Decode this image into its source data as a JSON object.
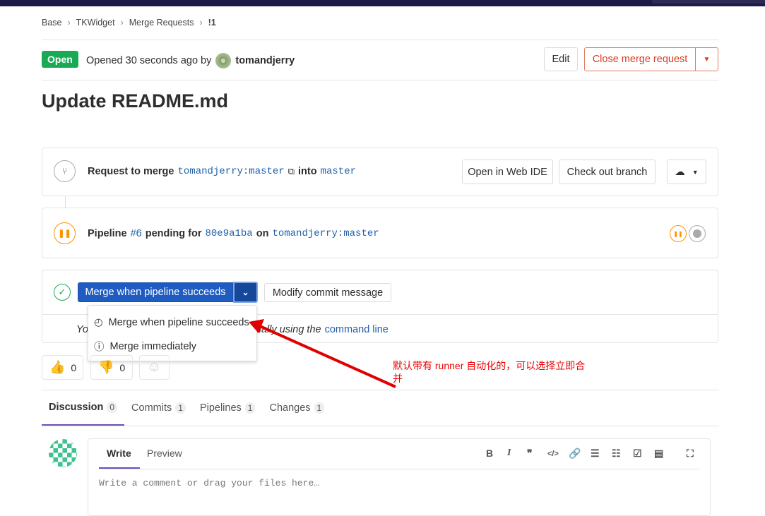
{
  "breadcrumb": [
    "Base",
    "TKWidget",
    "Merge Requests",
    "!1"
  ],
  "status": "Open",
  "opened_text": "Opened 30 seconds ago by",
  "author": "tomandjerry",
  "edit": "Edit",
  "close_mr": "Close merge request",
  "title": "Update README.md",
  "request": {
    "label": "Request to merge",
    "source": "tomandjerry:master",
    "into": "into",
    "target": "master",
    "web_ide": "Open in Web IDE",
    "checkout": "Check out branch"
  },
  "pipeline": {
    "label": "Pipeline",
    "id": "#6",
    "status": "pending for",
    "commit": "80e9a1ba",
    "on": "on",
    "branch": "tomandjerry:master"
  },
  "merge": {
    "button": "Merge when pipeline succeeds",
    "modify": "Modify commit message",
    "manual_text": "You can merge this merge request manually using the",
    "cmd_link": "command line",
    "options": [
      "Merge when pipeline succeeds",
      "Merge immediately"
    ]
  },
  "emoji": {
    "up": "0",
    "down": "0"
  },
  "tabs": [
    {
      "label": "Discussion",
      "count": "0"
    },
    {
      "label": "Commits",
      "count": "1"
    },
    {
      "label": "Pipelines",
      "count": "1"
    },
    {
      "label": "Changes",
      "count": "1"
    }
  ],
  "editor": {
    "write": "Write",
    "preview": "Preview",
    "placeholder": "Write a comment or drag your files here…"
  },
  "annotation": "默认带有 runner 自动化的，可以选择立即合并",
  "colors": {
    "accent": "#1f5fa8",
    "open": "#1aaa55",
    "danger": "#db3b21",
    "pending": "#fc9403",
    "annotation": "#e00000"
  }
}
